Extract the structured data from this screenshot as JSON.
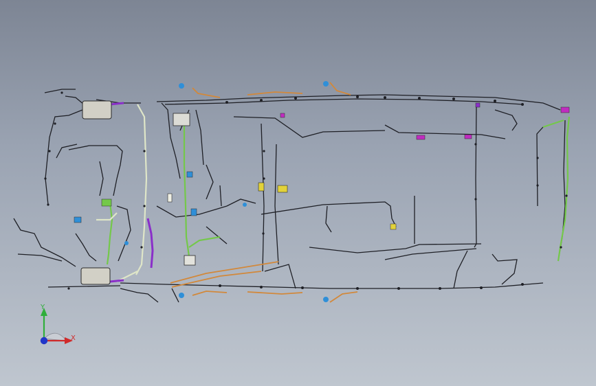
{
  "view": {
    "background_top": "#7d8594",
    "background_bottom": "#bfc6cf"
  },
  "harness_colors": {
    "main": "#1e1f25",
    "green": "#74c84a",
    "purple": "#8a2fc9",
    "orange": "#d2883a",
    "cream": "#dfe6c8",
    "blue": "#2f8fd8",
    "yellow": "#e2d23a",
    "magenta": "#c02cc0",
    "connector_block": "#d2d0c6"
  },
  "icons": [
    "axis-triad-icon",
    "connector-icon",
    "fuse-box-icon"
  ],
  "triad": {
    "x_label": "X",
    "y_label": "Y",
    "x_color": "#d02a2a",
    "y_color": "#2fae3a",
    "z_color": "#2136c9"
  }
}
